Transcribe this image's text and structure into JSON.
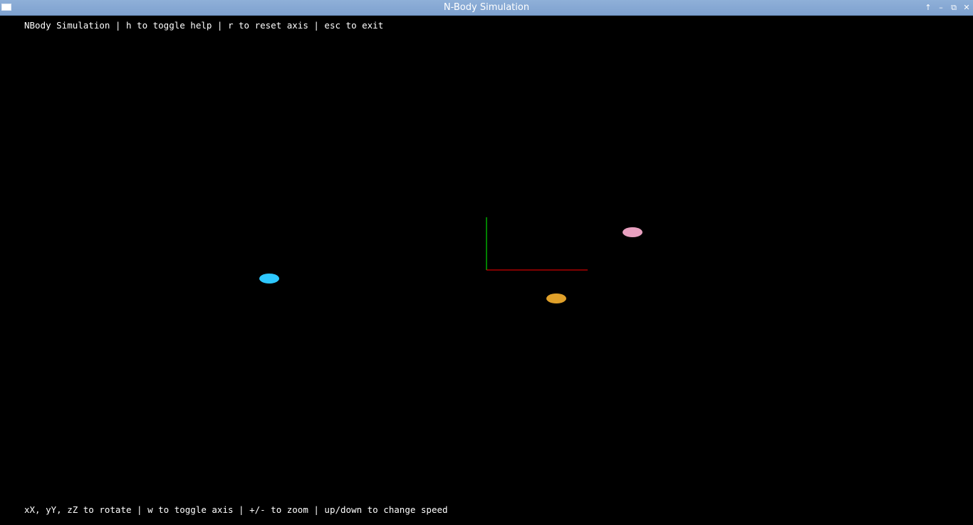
{
  "window": {
    "title": "N-Body Simulation",
    "buttons": {
      "shade_glyph": "↑",
      "minimize_glyph": "–",
      "maximize_glyph": "⧉",
      "close_glyph": "✕"
    }
  },
  "help": {
    "top": "NBody Simulation | h to toggle help | r to reset axis | esc to exit",
    "bottom": "xX, yY, zZ to rotate | w to toggle axis | +/- to zoom | up/down to change speed"
  },
  "scene": {
    "background": "#000000",
    "axes": {
      "x_color": "#ff0000",
      "y_color": "#00ff00"
    },
    "bodies": [
      {
        "name": "cyan-body",
        "color": "#2ec8ff"
      },
      {
        "name": "pink-body",
        "color": "#e8a0bf"
      },
      {
        "name": "orange-body",
        "color": "#e0a02a"
      }
    ]
  }
}
